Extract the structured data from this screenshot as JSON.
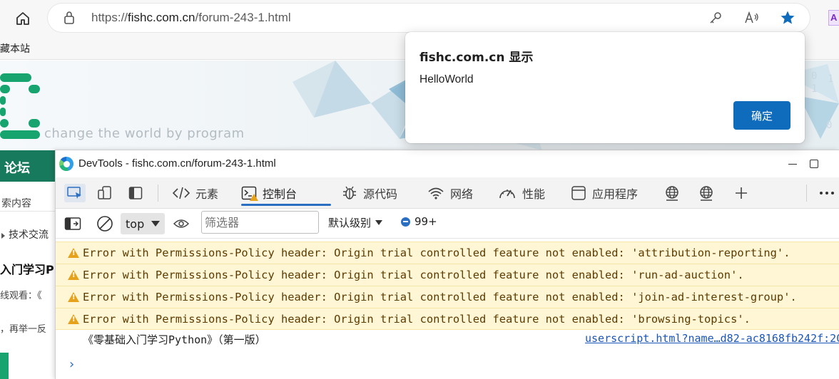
{
  "browser": {
    "url_prefix": "https://",
    "url_host": "fishc.com.cn",
    "url_path": "/forum-243-1.html",
    "favorites_text": "藏本站",
    "ext_letter": "A",
    "star_color": "#0f6cbd"
  },
  "page": {
    "slogan": "change the world by program",
    "nav_label": "论坛",
    "search_text": "索内容",
    "crumb": "技术交流",
    "post_title": "入门学习P",
    "line1": "线观看：《",
    "line2": "，再举一反",
    "brand_green": "#17a46f"
  },
  "alert": {
    "title": "fishc.com.cn 显示",
    "message": "HelloWorld",
    "ok_label": "确定"
  },
  "devtools": {
    "title": "DevTools - fishc.com.cn/forum-243-1.html",
    "tabs": [
      {
        "label": "元素"
      },
      {
        "label": "控制台"
      },
      {
        "label": "源代码"
      },
      {
        "label": "网络"
      },
      {
        "label": "性能"
      },
      {
        "label": "应用程序"
      }
    ],
    "console": {
      "context": "top",
      "filter_placeholder": "筛选器",
      "level": "默认级别",
      "issues_count": "99+",
      "warnings": [
        "Error with Permissions-Policy header: Origin trial controlled feature not enabled: 'attribution-reporting'.",
        "Error with Permissions-Policy header: Origin trial controlled feature not enabled: 'run-ad-auction'.",
        "Error with Permissions-Policy header: Origin trial controlled feature not enabled: 'join-ad-interest-group'.",
        "Error with Permissions-Policy header: Origin trial controlled feature not enabled: 'browsing-topics'."
      ],
      "log_message": "《零基础入门学习Python》（第一版）",
      "log_source": "userscript.html?name…d82-ac8168fb242f:20",
      "prompt": "›"
    },
    "accent": "#2b6fc2"
  }
}
